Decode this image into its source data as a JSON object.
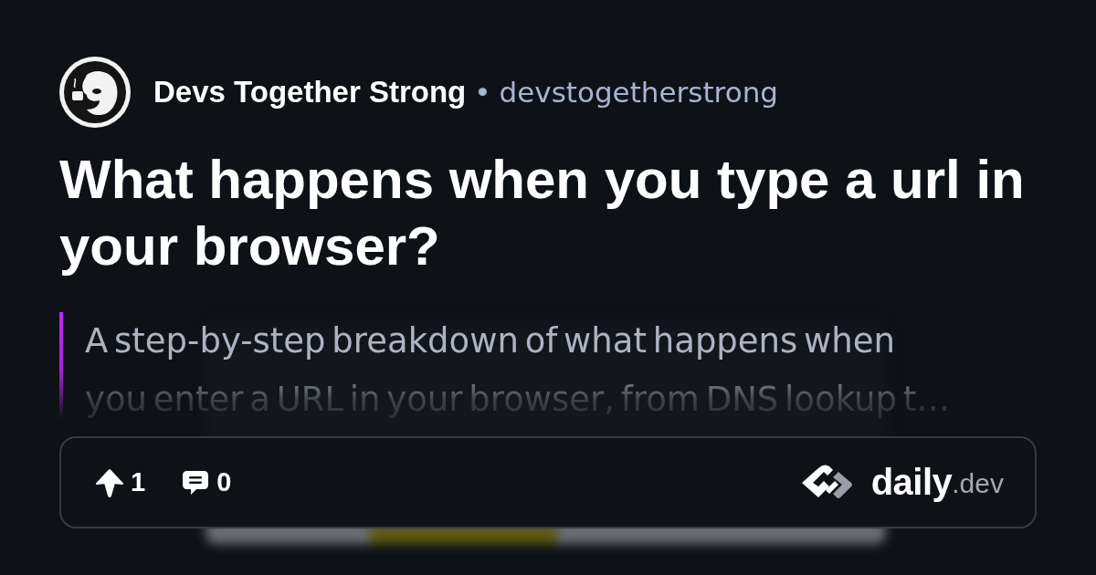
{
  "source": {
    "name": "Devs Together Strong",
    "separator": "•",
    "handle": "devstogetherstrong"
  },
  "post": {
    "title": "What happens when you type a url in your browser?",
    "summary": "A step-by-step breakdown of what happens when you enter a URL in your browser, from DNS lookup t…"
  },
  "stats": {
    "upvotes": "1",
    "comments": "0"
  },
  "brand": {
    "name": "daily",
    "suffix": ".dev"
  }
}
